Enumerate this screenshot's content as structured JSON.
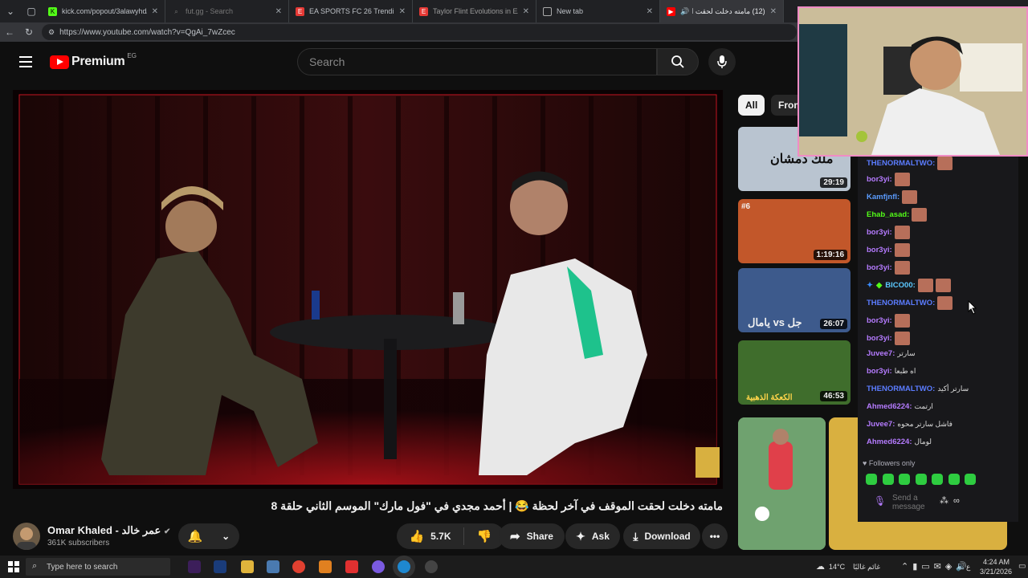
{
  "browser": {
    "tabs": [
      {
        "title": "kick.com/popout/3alawyhd/",
        "favicon_color": "#53fc18"
      },
      {
        "title": "fut.gg - Search",
        "favicon_color": "#555555"
      },
      {
        "title": "EA SPORTS FC 26 Trending Evolut",
        "favicon_color": "#e53935"
      },
      {
        "title": "Taylor Flint Evolutions in EA FC 2",
        "favicon_color": "#e53935"
      },
      {
        "title": "New tab",
        "favicon_color": "#888888"
      },
      {
        "title": "(12) مامته دخلت لحقت الموقف",
        "favicon_color": "#ff0000"
      }
    ],
    "url": "https://www.youtube.com/watch?v=QgAi_7wZcec"
  },
  "youtube": {
    "logo": "Premium",
    "country": "EG",
    "search_placeholder": "Search",
    "video_title": "مامته دخلت لحقت الموقف في آخر لحظة 😂 | أحمد مجدي في \"فول مارك\" الموسم الثاني حلقة 8",
    "channel": "Omar Khaled - عمر خالد",
    "subscribers": "361K subscribers",
    "likes": "5.7K",
    "share": "Share",
    "ask": "Ask",
    "download": "Download",
    "chips": [
      "All",
      "From"
    ],
    "recommendations": [
      {
        "duration": "29:19",
        "thumb_color": "#b9c4d0",
        "overlay": "ملك دمشان"
      },
      {
        "duration": "1:19:16",
        "thumb_color": "#c2572a",
        "overlay": "#6"
      },
      {
        "duration": "26:07",
        "thumb_color": "#3d5a8c",
        "overlay": "جل vs يامال"
      },
      {
        "duration": "46:53",
        "thumb_color": "#3f6d2c",
        "overlay": "الكعكة الذهبية"
      }
    ]
  },
  "chat": {
    "messages": [
      {
        "user": "THENORMALTWO",
        "color": "#5b7cff",
        "emotes": 1,
        "text": ""
      },
      {
        "user": "bor3yi",
        "color": "#b57bff",
        "emotes": 1,
        "text": ""
      },
      {
        "user": "Kamfjnfl",
        "color": "#5b9cff",
        "emotes": 1,
        "text": ""
      },
      {
        "user": "Ehab_asad",
        "color": "#53fc18",
        "emotes": 1,
        "text": ""
      },
      {
        "user": "bor3yi",
        "color": "#b57bff",
        "emotes": 1,
        "text": ""
      },
      {
        "user": "bor3yi",
        "color": "#b57bff",
        "emotes": 1,
        "text": ""
      },
      {
        "user": "bor3yi",
        "color": "#b57bff",
        "emotes": 1,
        "text": ""
      },
      {
        "user": "BICO00",
        "color": "#5bc8ff",
        "emotes": 2,
        "text": ""
      },
      {
        "user": "THENORMALTWO",
        "color": "#5b7cff",
        "emotes": 1,
        "text": ""
      },
      {
        "user": "bor3yi",
        "color": "#b57bff",
        "emotes": 1,
        "text": ""
      },
      {
        "user": "bor3yi",
        "color": "#b57bff",
        "emotes": 1,
        "text": ""
      },
      {
        "user": "Juvee7",
        "color": "#b57bff",
        "emotes": 0,
        "text": "سارتر"
      },
      {
        "user": "bor3yi",
        "color": "#b57bff",
        "emotes": 0,
        "text": "اه طبعا"
      },
      {
        "user": "THENORMALTWO",
        "color": "#5b7cff",
        "emotes": 0,
        "text": "سارتر أكيد"
      },
      {
        "user": "Ahmed6224",
        "color": "#b57bff",
        "emotes": 0,
        "text": "ارتمت"
      },
      {
        "user": "Juvee7",
        "color": "#b57bff",
        "emotes": 0,
        "text": "فاشل سارتر محوه"
      },
      {
        "user": "Ahmed6224",
        "color": "#b57bff",
        "emotes": 0,
        "text": "لومال"
      }
    ],
    "followers_only": "Followers only",
    "send_placeholder": "Send a message"
  },
  "taskbar": {
    "search_placeholder": "Type here to search",
    "weather": "14°C",
    "weather_text": "غائم غالبًا",
    "time": "4:24 AM",
    "date": "3/21/2026",
    "lang": "ع"
  }
}
